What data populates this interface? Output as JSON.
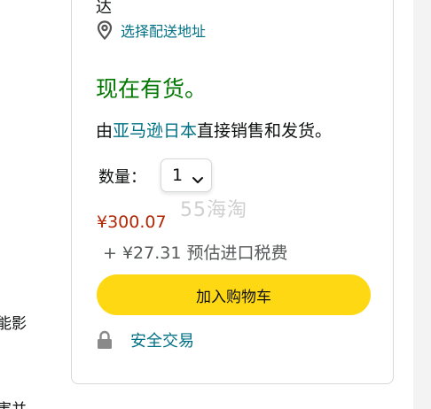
{
  "left_column": {
    "fragment_1": "能影",
    "fragment_2": "害并"
  },
  "buybox": {
    "top_fragment": "达",
    "deliver_link": "选择配送地址",
    "availability": "现在有货。",
    "seller": {
      "prefix": "由",
      "link": "亚马逊日本",
      "suffix": "直接销售和发货。"
    },
    "quantity": {
      "label": "数量：",
      "value": "1"
    },
    "watermark": "55海淘",
    "price": "¥300.07",
    "import_fee": "+ ¥27.31 预估进口税费",
    "add_to_cart": "加入购物车",
    "secure_transaction": "安全交易"
  },
  "icons": {
    "location": "location-pin-icon",
    "dropdown": "chevron-down-icon",
    "lock": "lock-icon"
  },
  "colors": {
    "link": "#007185",
    "in_stock": "#007600",
    "price": "#b12704",
    "button": "#ffd814"
  }
}
